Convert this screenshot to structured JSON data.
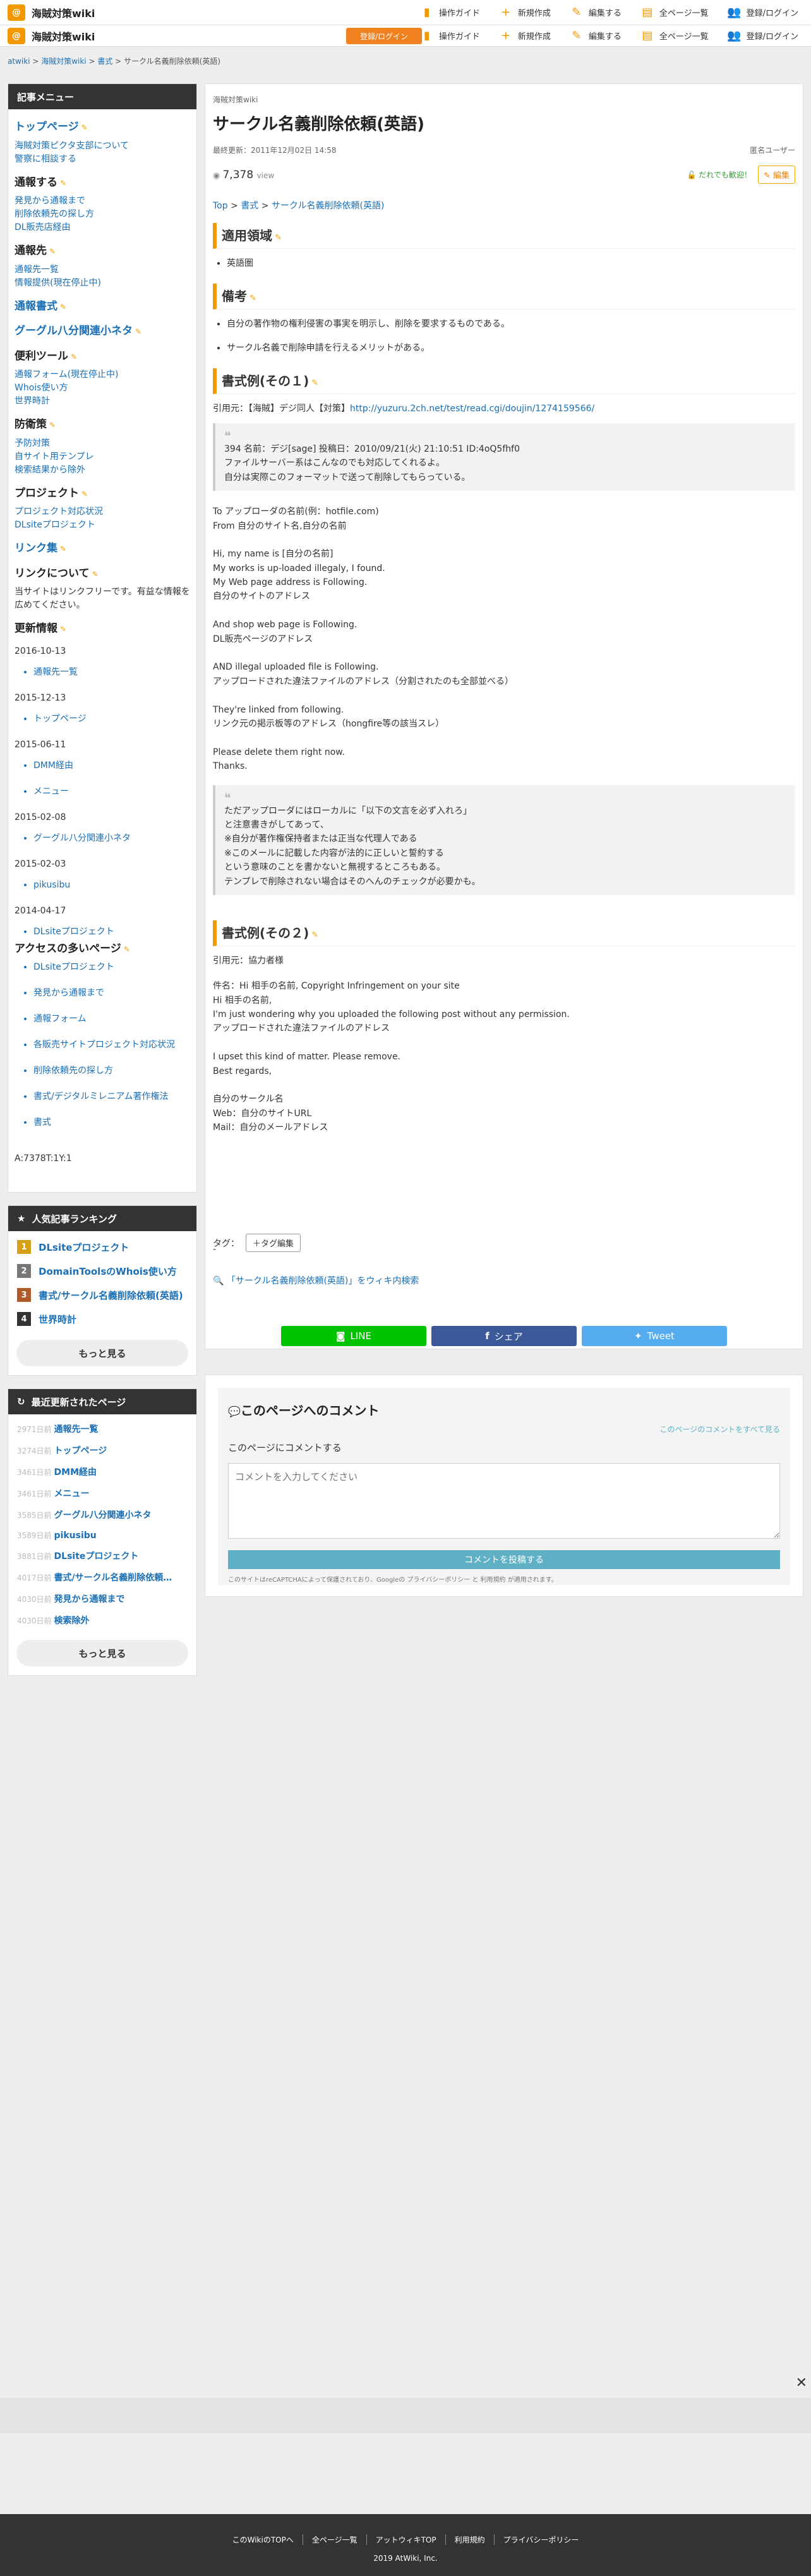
{
  "header": {
    "logo_mark": "@",
    "title": "海賊対策wiki",
    "nav": [
      {
        "label": "操作ガイド",
        "icon": "guide-icon"
      },
      {
        "label": "新規作成",
        "icon": "plus-icon"
      },
      {
        "label": "編集する",
        "icon": "pencil-icon"
      },
      {
        "label": "全ページ一覧",
        "icon": "document-icon"
      },
      {
        "label": "登録/ログイン",
        "icon": "users-icon"
      }
    ],
    "register_label": "登録/ログイン"
  },
  "breadcrumb": [
    "atwiki",
    "海賊対策wiki",
    "書式",
    "サークル名義削除依頼(英語)"
  ],
  "sidebar": {
    "menu_title": "記事メニュー",
    "menu": {
      "sec_top": "トップページ",
      "top_links": [
        "海賊対策ピクタ支部について",
        "警察に相談する"
      ],
      "sec_report": "通報する",
      "report_links": [
        "発見から通報まで",
        "削除依頼先の探し方",
        "DL販売店経由"
      ],
      "sec_dest": "通報先",
      "dest_links": [
        "通報先一覧",
        "情報提供(現在停止中)"
      ],
      "sec_form": "通報書式",
      "sec_google": "グーグル八分関連小ネタ",
      "sec_tools": "便利ツール",
      "tools_links": [
        "通報フォーム(現在停止中)",
        "Whois使い方",
        "世界時計"
      ],
      "sec_prevent": "防衛策",
      "prevent_links": [
        "予防対策",
        "自サイト用テンプレ",
        "検索結果から除外"
      ],
      "sec_project": "プロジェクト",
      "project_links": [
        "プロジェクト対応状況",
        "DLsiteプロジェクト"
      ],
      "sec_linkcollect": "リンク集",
      "sec_about": "リンクについて",
      "about_note": "当サイトはリンクフリーです。有益な情報を広めてください。",
      "sec_updates": "更新情報",
      "updates": [
        {
          "date": "2016-10-13",
          "item": "通報先一覧"
        },
        {
          "date": "2015-12-13",
          "item": "トップページ"
        },
        {
          "date": "2015-06-11",
          "items": [
            "DMM経由",
            "メニュー"
          ]
        },
        {
          "date": "2015-02-08",
          "item": "グーグル八分関連小ネタ"
        },
        {
          "date": "2015-02-03",
          "item": "pikusibu"
        },
        {
          "date": "2014-04-17",
          "item": "DLsiteプロジェクト"
        }
      ],
      "sec_popular": "アクセスの多いページ",
      "popular": [
        "DLsiteプロジェクト",
        "発見から通報まで",
        "通報フォーム",
        "各販売サイトプロジェクト対応状況",
        "削除依頼先の探し方",
        "書式/デジタルミレニアム著作権法",
        "書式"
      ],
      "counter": "A:7378T:1Y:1"
    },
    "ranking_title": "人気記事ランキング",
    "ranking": [
      {
        "num": "1",
        "label": "DLsiteプロジェクト",
        "color": "#d4a017"
      },
      {
        "num": "2",
        "label": "DomainToolsのWhois使い方",
        "color": "#777777"
      },
      {
        "num": "3",
        "label": "書式/サークル名義削除依頼(英語)",
        "color": "#b05a2a"
      },
      {
        "num": "4",
        "label": "世界時計",
        "color": "#333333"
      }
    ],
    "more_label": "もっと見る",
    "recent_title": "最近更新されたページ",
    "recent": [
      {
        "cnt": "2971日前",
        "label": "通報先一覧"
      },
      {
        "cnt": "3274日前",
        "label": "トップページ"
      },
      {
        "cnt": "3461日前",
        "label": "DMM経由"
      },
      {
        "cnt": "3461日前",
        "label": "メニュー"
      },
      {
        "cnt": "3585日前",
        "label": "グーグル八分関連小ネタ"
      },
      {
        "cnt": "3589日前",
        "label": "pikusibu"
      },
      {
        "cnt": "3881日前",
        "label": "DLsiteプロジェクト"
      },
      {
        "cnt": "4017日前",
        "label": "書式/サークル名義削除依頼(..."
      },
      {
        "cnt": "4030日前",
        "label": "発見から通報まで"
      },
      {
        "cnt": "4030日前",
        "label": "検索除外"
      }
    ]
  },
  "main": {
    "wiki_name": "海賊対策wiki",
    "title": "サークル名義削除依頼(英語)",
    "last_updated": "最終更新：2011年12月02日 14:58",
    "author": "匿名ユーザー",
    "views": "7,378",
    "views_unit": "view",
    "follow_label": "だれでも歓迎！",
    "edit_label": "編集",
    "page_breadcrumb": [
      "Top",
      "書式",
      "サークル名義削除依頼(英語)"
    ],
    "h_scope": "適用領域",
    "scope_items": [
      "英語圏"
    ],
    "h_notes": "備考",
    "notes_items": [
      "自分の著作物の権利侵害の事実を明示し、削除を要求するものである。",
      "サークル名義で削除申請を行えるメリットがある。"
    ],
    "h_form1": "書式例(その１)",
    "cite1_prefix": "引用元：【海賊】デジ同人【対策】",
    "cite1_url": "http://yuzuru.2ch.net/test/read.cgi/doujin/1274159566/",
    "quote1": [
      "394 名前：デジ[sage] 投稿日：2010/09/21(火) 21:10:51 ID:4oQ5fhf0",
      "ファイルサーバー系はこんなのでも対応してくれるよ。",
      "自分は実際このフォーマットで送って削除してもらっている。"
    ],
    "letter1": [
      "To アップローダの名前(例：hotfile.com)",
      "From 自分のサイト名,自分の名前",
      "",
      "Hi, my name is [自分の名前]",
      "My works is up-loaded illegaly, I found.",
      "My Web page address is Following.",
      "自分のサイトのアドレス",
      "",
      "And shop web page is Following.",
      "DL販売ページのアドレス",
      "",
      "AND illegal uploaded file is Following.",
      "アップロードされた違法ファイルのアドレス（分割されたのも全部並べる）",
      "",
      "They're linked from following.",
      "リンク元の掲示板等のアドレス（hongfire等の該当スレ）",
      "",
      "Please delete them right now.",
      "Thanks."
    ],
    "quote2": [
      "ただアップローダにはローカルに「以下の文言を必ず入れろ」",
      "と注意書きがしてあって、",
      "※自分が著作権保持者または正当な代理人である",
      "※このメールに記載した内容が法的に正しいと誓約する",
      "という意味のことを書かないと無視するところもある。",
      "テンプレで削除されない場合はそのへんのチェックが必要かも。"
    ],
    "h_form2": "書式例(その２)",
    "cite2": "引用元：協力者様",
    "letter2": [
      "件名：Hi 相手の名前, Copyright Infringement on your site",
      "Hi 相手の名前,",
      "I'm just wondering why you uploaded the following post without any permission.",
      "アップロードされた違法ファイルのアドレス",
      "",
      "I upset this kind of matter. Please remove.",
      "Best regards,",
      "",
      "自分のサークル名",
      "Web：自分のサイトURL",
      "Mail：自分のメールアドレス"
    ],
    "dot": "-",
    "tag_label": "タグ：",
    "tag_edit": "＋タグ編集",
    "wiki_search": "「サークル名義削除依頼(英語)」をウィキ内検索",
    "share": [
      {
        "label": "LINE",
        "color": "#00c300"
      },
      {
        "label": "シェア",
        "color": "#3b5998"
      },
      {
        "label": "Tweet",
        "color": "#55acee"
      }
    ]
  },
  "comments": {
    "title": "このページへのコメント",
    "view_all": "このページのコメントをすべて見る",
    "label": "このページにコメントする",
    "placeholder": "コメントを入力してください",
    "submit": "コメントを投稿する",
    "note": "このサイトはreCAPTCHAによって保護されており、Googleの プライバシーポリシー と 利用規約 が適用されます。"
  },
  "footer": {
    "links": [
      "このWikiのTOPへ",
      "全ページ一覧",
      "アットウィキTOP",
      "利用規約",
      "プライバシーポリシー"
    ],
    "copyright": "2019 AtWiki, Inc."
  }
}
